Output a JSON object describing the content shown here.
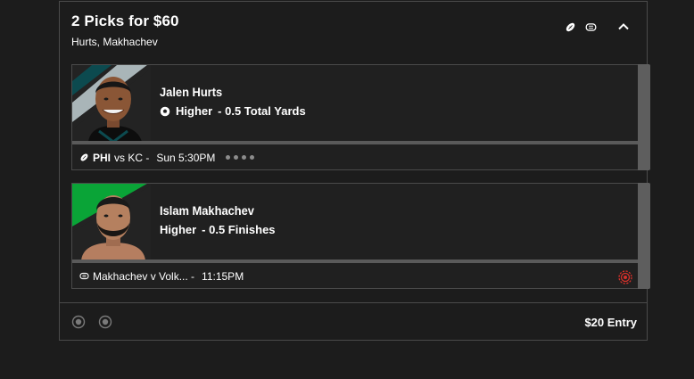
{
  "entry": {
    "title": "2 Picks for $60",
    "subtitle": "Hurts, Makhachev",
    "header_icons": [
      "football-icon",
      "mma-glove-icon",
      "chevron-up-icon"
    ],
    "entry_amount": "$20 Entry"
  },
  "picks": [
    {
      "player_name": "Jalen Hurts",
      "direction": "Higher",
      "market": "- 0.5 Total Yards",
      "direction_icon": "soccer-ball-icon",
      "sport_icon": "football-icon",
      "team": "PHI",
      "opponent": "vs KC -",
      "game_time": "Sun 5:30PM",
      "progress_dots": 4,
      "stripe_colors": [
        "#0c4a4f",
        "#a9b5b8"
      ]
    },
    {
      "player_name": "Islam Makhachev",
      "direction": "Higher",
      "market": "- 0.5 Finishes",
      "sport_icon": "mma-glove-icon",
      "matchup": "Makhachev v Volk... -",
      "game_time": "11:15PM",
      "live_icon": "live-broadcast-icon",
      "stripe_colors": [
        "#0aa437",
        "#0aa437"
      ]
    }
  ],
  "colors": {
    "background": "#1c1c1c",
    "card_border": "#4a4a4a",
    "live_red": "#d5302a"
  }
}
